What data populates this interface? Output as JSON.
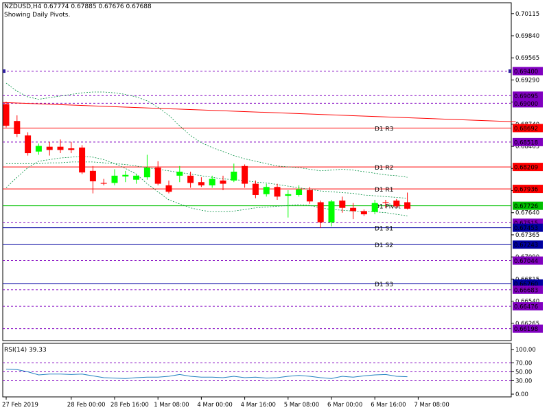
{
  "header": {
    "symbol_line": "NZDUSD,H4  0.67774 0.67885 0.67676 0.67688",
    "subtitle": "Showing Daily Pivots."
  },
  "colors": {
    "bull": "#00ff00",
    "bear": "#ff0000",
    "pivot": "#00c000",
    "resistance": "#ff0000",
    "support": "#0000a0",
    "dashed": "#8000c0",
    "band": "#009040",
    "rsi": "#2080c0"
  },
  "chart_data": [
    {
      "type": "candlestick",
      "title": "NZDUSD,H4",
      "ylim": [
        0.6605,
        0.7025
      ],
      "yticks": [
        "0.70115",
        "0.69840",
        "0.69565",
        "0.69290",
        "0.69015",
        "0.68740",
        "0.68465",
        "0.68190",
        "0.67915",
        "0.67640",
        "0.67365",
        "0.67090",
        "0.66815",
        "0.66540",
        "0.66265"
      ],
      "xticks": [
        {
          "i": 0,
          "label": "27 Feb 2019"
        },
        {
          "i": 6,
          "label": "28 Feb 00:00"
        },
        {
          "i": 10,
          "label": "28 Feb 16:00"
        },
        {
          "i": 14,
          "label": "1 Mar 08:00"
        },
        {
          "i": 18,
          "label": "4 Mar 00:00"
        },
        {
          "i": 22,
          "label": "4 Mar 16:00"
        },
        {
          "i": 26,
          "label": "5 Mar 08:00"
        },
        {
          "i": 30,
          "label": "6 Mar 00:00"
        },
        {
          "i": 34,
          "label": "6 Mar 16:00"
        },
        {
          "i": 38,
          "label": "7 Mar 08:00"
        }
      ],
      "candles": [
        {
          "o": 0.6899,
          "h": 0.6902,
          "l": 0.687,
          "c": 0.6872
        },
        {
          "o": 0.6878,
          "h": 0.6885,
          "l": 0.6858,
          "c": 0.6862
        },
        {
          "o": 0.686,
          "h": 0.6864,
          "l": 0.6835,
          "c": 0.6838
        },
        {
          "o": 0.684,
          "h": 0.685,
          "l": 0.6836,
          "c": 0.6847
        },
        {
          "o": 0.6846,
          "h": 0.6852,
          "l": 0.6835,
          "c": 0.6842
        },
        {
          "o": 0.6846,
          "h": 0.6855,
          "l": 0.6838,
          "c": 0.6842
        },
        {
          "o": 0.6844,
          "h": 0.6852,
          "l": 0.6838,
          "c": 0.6842
        },
        {
          "o": 0.6845,
          "h": 0.6848,
          "l": 0.6812,
          "c": 0.6814
        },
        {
          "o": 0.6816,
          "h": 0.6822,
          "l": 0.6788,
          "c": 0.6803
        },
        {
          "o": 0.6801,
          "h": 0.6806,
          "l": 0.6798,
          "c": 0.68
        },
        {
          "o": 0.6801,
          "h": 0.6818,
          "l": 0.6798,
          "c": 0.681
        },
        {
          "o": 0.6809,
          "h": 0.6816,
          "l": 0.6802,
          "c": 0.6811
        },
        {
          "o": 0.6805,
          "h": 0.6812,
          "l": 0.68,
          "c": 0.681
        },
        {
          "o": 0.6808,
          "h": 0.6836,
          "l": 0.6805,
          "c": 0.682
        },
        {
          "o": 0.682,
          "h": 0.6828,
          "l": 0.6798,
          "c": 0.68
        },
        {
          "o": 0.6798,
          "h": 0.6804,
          "l": 0.6788,
          "c": 0.679
        },
        {
          "o": 0.681,
          "h": 0.6822,
          "l": 0.6802,
          "c": 0.6815
        },
        {
          "o": 0.681,
          "h": 0.6815,
          "l": 0.6795,
          "c": 0.6801
        },
        {
          "o": 0.6802,
          "h": 0.6808,
          "l": 0.6796,
          "c": 0.6798
        },
        {
          "o": 0.6798,
          "h": 0.681,
          "l": 0.6795,
          "c": 0.6806
        },
        {
          "o": 0.6804,
          "h": 0.681,
          "l": 0.6792,
          "c": 0.68
        },
        {
          "o": 0.6804,
          "h": 0.6825,
          "l": 0.6802,
          "c": 0.6815
        },
        {
          "o": 0.6822,
          "h": 0.6824,
          "l": 0.6795,
          "c": 0.68
        },
        {
          "o": 0.68,
          "h": 0.6804,
          "l": 0.6782,
          "c": 0.6786
        },
        {
          "o": 0.6787,
          "h": 0.68,
          "l": 0.6784,
          "c": 0.6796
        },
        {
          "o": 0.6796,
          "h": 0.68,
          "l": 0.678,
          "c": 0.6784
        },
        {
          "o": 0.6785,
          "h": 0.6792,
          "l": 0.6758,
          "c": 0.6787
        },
        {
          "o": 0.6786,
          "h": 0.6798,
          "l": 0.6784,
          "c": 0.6793
        },
        {
          "o": 0.6792,
          "h": 0.6796,
          "l": 0.6775,
          "c": 0.6778
        },
        {
          "o": 0.6777,
          "h": 0.6779,
          "l": 0.6745,
          "c": 0.6752
        },
        {
          "o": 0.6752,
          "h": 0.678,
          "l": 0.6747,
          "c": 0.6778
        },
        {
          "o": 0.6779,
          "h": 0.6784,
          "l": 0.6764,
          "c": 0.677
        },
        {
          "o": 0.677,
          "h": 0.6776,
          "l": 0.6756,
          "c": 0.6766
        },
        {
          "o": 0.6766,
          "h": 0.6768,
          "l": 0.676,
          "c": 0.6762
        },
        {
          "o": 0.6765,
          "h": 0.678,
          "l": 0.6762,
          "c": 0.6776
        },
        {
          "o": 0.6777,
          "h": 0.678,
          "l": 0.677,
          "c": 0.6776
        },
        {
          "o": 0.6779,
          "h": 0.6781,
          "l": 0.677,
          "c": 0.6772
        },
        {
          "o": 0.6777,
          "h": 0.6789,
          "l": 0.6768,
          "c": 0.6769
        }
      ],
      "levels": [
        {
          "price": 0.694,
          "label": "0.69400",
          "tag": "",
          "style": "dashed",
          "marker": true
        },
        {
          "price": 0.69095,
          "label": "0.69095",
          "tag": "",
          "style": "dashed"
        },
        {
          "price": 0.69,
          "label": "0.69000",
          "tag": "",
          "style": "dashed"
        },
        {
          "price": 0.68692,
          "label": "0.68692",
          "tag": "D1 R3",
          "style": "resistance"
        },
        {
          "price": 0.68518,
          "label": "0.68518",
          "tag": "",
          "style": "dashed"
        },
        {
          "price": 0.68209,
          "label": "0.68209",
          "tag": "D1 R2",
          "style": "resistance"
        },
        {
          "price": 0.67936,
          "label": "0.67936",
          "tag": "D1 R1",
          "style": "resistance"
        },
        {
          "price": 0.67726,
          "label": "0.67726",
          "tag": "D1 Pivot",
          "style": "pivot"
        },
        {
          "price": 0.67515,
          "label": "0.67515",
          "tag": "",
          "style": "dashed"
        },
        {
          "price": 0.67453,
          "label": "0.67453",
          "tag": "D1 S1",
          "style": "support"
        },
        {
          "price": 0.67243,
          "label": "0.67243",
          "tag": "D1 S2",
          "style": "support"
        },
        {
          "price": 0.67044,
          "label": "0.67044",
          "tag": "",
          "style": "dashed"
        },
        {
          "price": 0.6676,
          "label": "0.66760",
          "tag": "D1 S3",
          "style": "support"
        },
        {
          "price": 0.66683,
          "label": "0.66683",
          "tag": "",
          "style": "dashed"
        },
        {
          "price": 0.66476,
          "label": "0.66476",
          "tag": "",
          "style": "dashed"
        },
        {
          "price": 0.66198,
          "label": "0.66198",
          "tag": "",
          "style": "dashed"
        }
      ],
      "trendline": {
        "from": {
          "i": -0.3,
          "price": 0.6901
        },
        "to": {
          "i": 47,
          "price": 0.6877
        }
      },
      "band_upper": [
        0.6925,
        0.6915,
        0.6908,
        0.6905,
        0.6907,
        0.6909,
        0.6911,
        0.6913,
        0.6914,
        0.6914,
        0.6913,
        0.6911,
        0.6908,
        0.6903,
        0.6895,
        0.6885,
        0.6872,
        0.686,
        0.6851,
        0.6845,
        0.684,
        0.6835,
        0.6831,
        0.6828,
        0.6825,
        0.6822,
        0.6821,
        0.682,
        0.6818,
        0.6816,
        0.6817,
        0.6818,
        0.6817,
        0.6815,
        0.6813,
        0.6811,
        0.681,
        0.6808
      ],
      "band_middle": [
        0.6825,
        0.6825,
        0.6825,
        0.6825,
        0.6826,
        0.6826,
        0.6827,
        0.6827,
        0.6827,
        0.6826,
        0.6825,
        0.6824,
        0.6822,
        0.682,
        0.6818,
        0.6816,
        0.6814,
        0.6812,
        0.681,
        0.6808,
        0.6806,
        0.6805,
        0.6804,
        0.6802,
        0.6801,
        0.6799,
        0.6797,
        0.6795,
        0.6793,
        0.6791,
        0.679,
        0.6789,
        0.6788,
        0.6786,
        0.6785,
        0.6784,
        0.6783,
        0.6782
      ],
      "band_lower": [
        0.6795,
        0.6808,
        0.682,
        0.6828,
        0.683,
        0.6832,
        0.6833,
        0.6834,
        0.6833,
        0.683,
        0.6825,
        0.6819,
        0.6812,
        0.68,
        0.679,
        0.678,
        0.6775,
        0.677,
        0.6767,
        0.6765,
        0.6765,
        0.6766,
        0.6768,
        0.677,
        0.6771,
        0.6772,
        0.6773,
        0.6774,
        0.6773,
        0.677,
        0.6768,
        0.6767,
        0.6766,
        0.6765,
        0.6765,
        0.6764,
        0.6762,
        0.676
      ]
    },
    {
      "type": "line",
      "title": "RSI(14) 39.33",
      "ylim": [
        0,
        100
      ],
      "yticks": [
        "100.00",
        "70.00",
        "50.00",
        "30.00",
        "0.00"
      ],
      "levels": [
        70,
        50,
        30
      ],
      "values": [
        56,
        55,
        50,
        43,
        45,
        45,
        44,
        45,
        41,
        37,
        36,
        35,
        37,
        38,
        38,
        40,
        44,
        40,
        38,
        38,
        37,
        40,
        37,
        38,
        36,
        37,
        40,
        42,
        40,
        37,
        35,
        40,
        38,
        41,
        43,
        44,
        40,
        39
      ]
    }
  ]
}
